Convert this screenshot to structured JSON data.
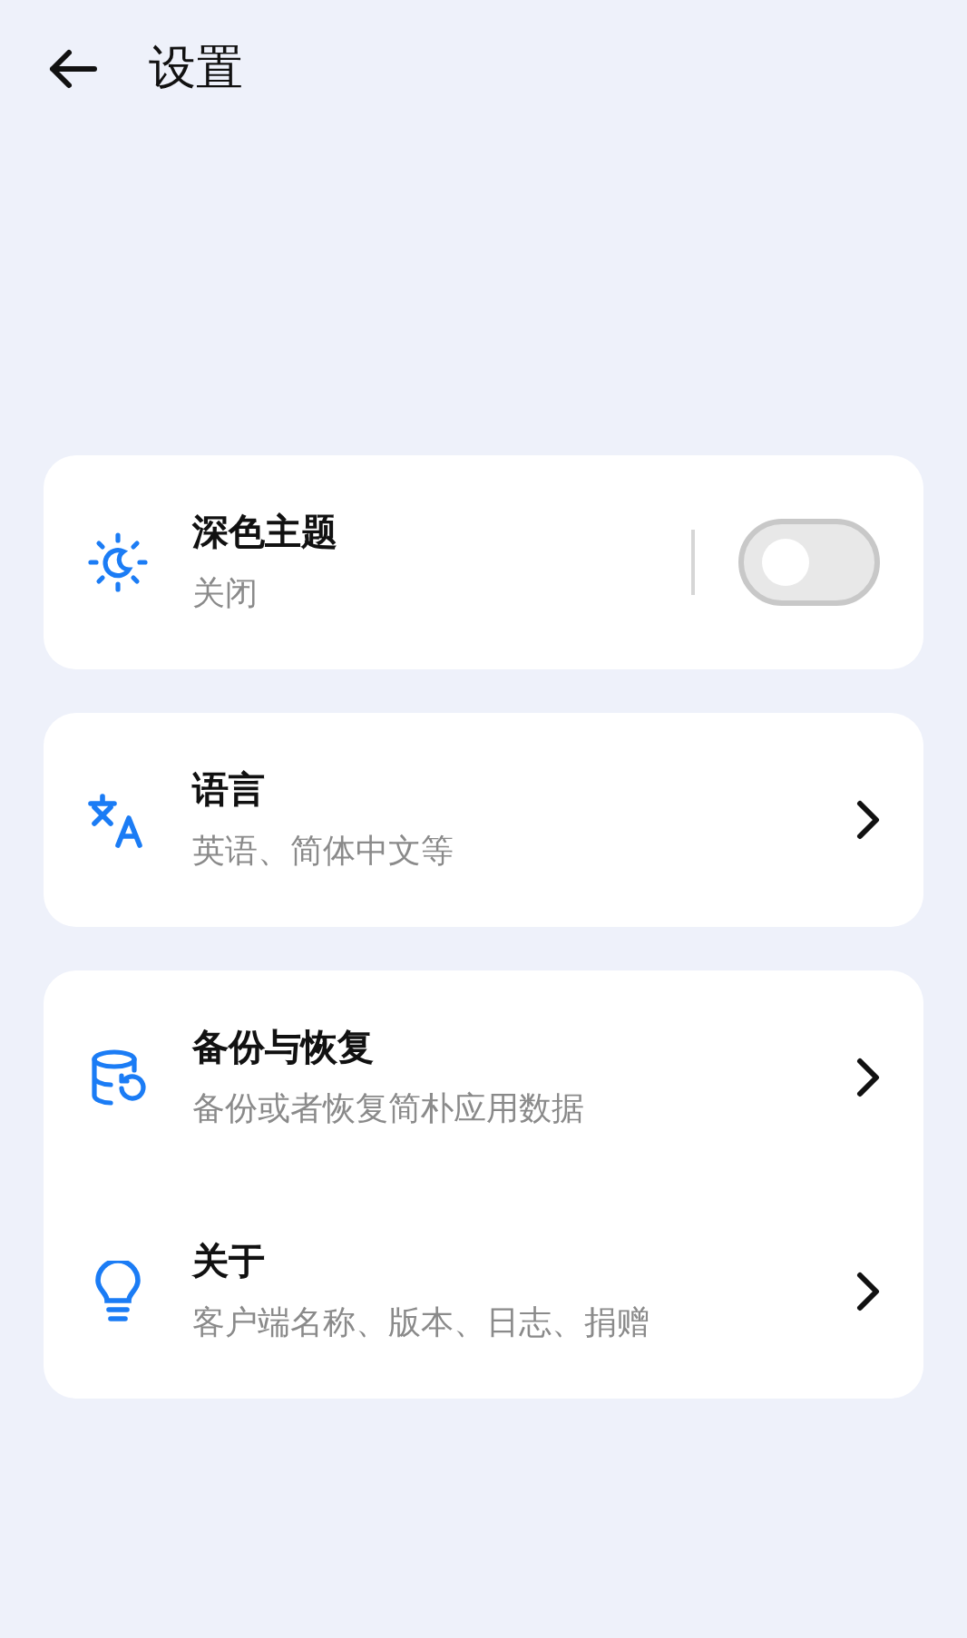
{
  "header": {
    "title": "设置"
  },
  "groups": [
    {
      "items": [
        {
          "kind": "switch",
          "title": "深色主题",
          "subtitle": "关闭",
          "on": false
        }
      ]
    },
    {
      "items": [
        {
          "kind": "link",
          "title": "语言",
          "subtitle": "英语、简体中文等"
        }
      ]
    },
    {
      "items": [
        {
          "kind": "link",
          "title": "备份与恢复",
          "subtitle": "备份或者恢复简朴应用数据"
        },
        {
          "kind": "link",
          "title": "关于",
          "subtitle": "客户端名称、版本、日志、捐赠"
        }
      ]
    }
  ]
}
